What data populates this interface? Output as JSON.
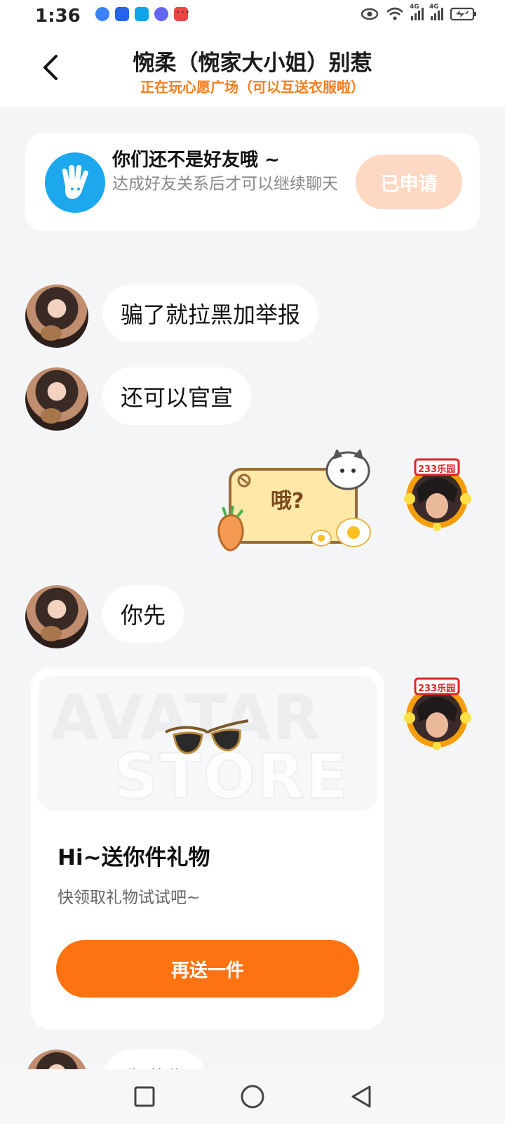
{
  "status": {
    "time": "1:36",
    "more": "···",
    "network_1": "4G",
    "network_2": "4G",
    "app_icons": [
      "blue-app-icon",
      "lightbulb-app-icon",
      "search-app-icon",
      "music-app-icon",
      "red-app-icon"
    ]
  },
  "header": {
    "title": "惋柔（惋家大小姐）别惹",
    "subtitle": "正在玩心愿广场（可以互送衣服啦）"
  },
  "notice": {
    "title": "你们还不是好友哦 ~",
    "desc": "达成好友关系后才可以继续聊天",
    "button": "已申请"
  },
  "messages": [
    {
      "side": "left",
      "text": "骗了就拉黑加举报"
    },
    {
      "side": "left",
      "text": "还可以官宣"
    },
    {
      "side": "right",
      "sticker_text": "哦?"
    },
    {
      "side": "left",
      "text": "你先"
    },
    {
      "side": "left",
      "text": "我邀你"
    }
  ],
  "avatar_badge": "233乐园",
  "gift": {
    "watermark_1": "AVATAR",
    "watermark_2": "STORE",
    "title": "Hi~送你件礼物",
    "desc": "快领取礼物试试吧~",
    "button": "再送一件"
  },
  "colors": {
    "accent_orange": "#fd7312",
    "subtitle_orange": "#f57d1f",
    "applied_button": "#fdd9c4",
    "notice_icon_blue": "#1da8ee",
    "background": "#f4f5f7"
  }
}
